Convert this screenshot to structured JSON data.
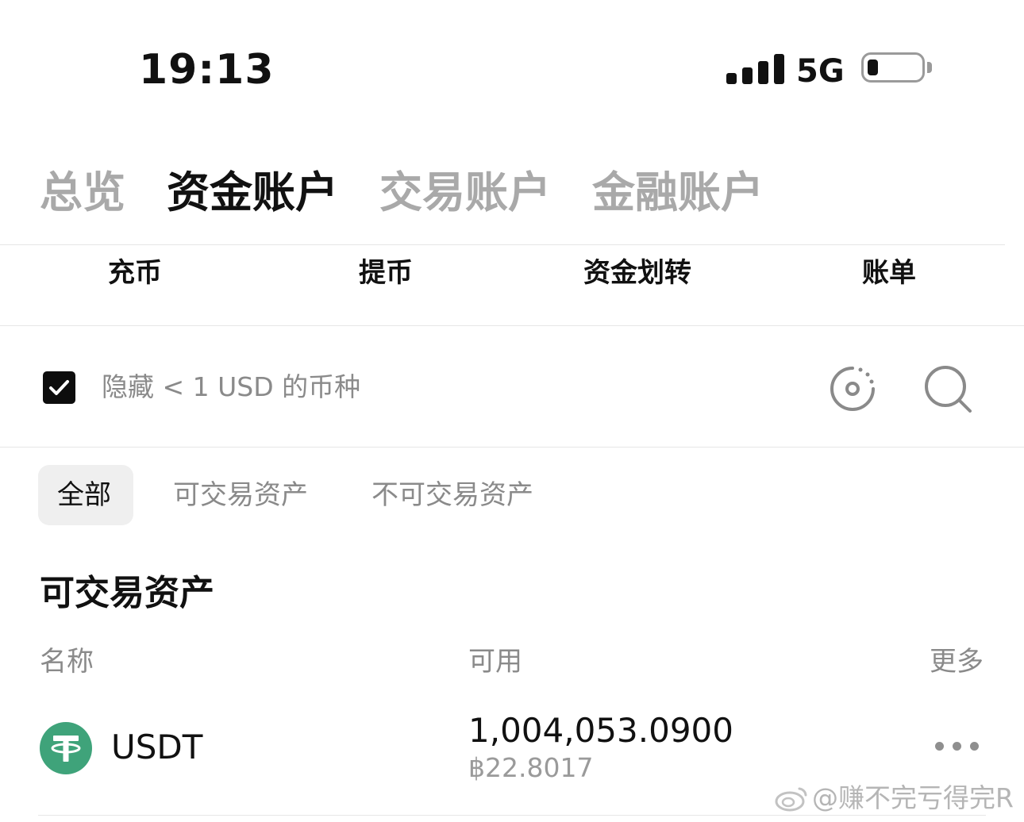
{
  "status_bar": {
    "time": "19:13",
    "network": "5G",
    "icons": [
      "signal-icon",
      "battery-icon"
    ]
  },
  "account_tabs": [
    {
      "label": "总览",
      "active": false
    },
    {
      "label": "资金账户",
      "active": true
    },
    {
      "label": "交易账户",
      "active": false
    },
    {
      "label": "金融账户",
      "active": false
    }
  ],
  "actions": [
    {
      "label": "充币"
    },
    {
      "label": "提币"
    },
    {
      "label": "资金划转"
    },
    {
      "label": "账单"
    }
  ],
  "filter": {
    "hide_small_label": "隐藏 < 1 USD 的币种",
    "hide_small_checked": true,
    "icons": [
      "target-icon",
      "search-icon"
    ]
  },
  "segments": [
    {
      "label": "全部",
      "active": true
    },
    {
      "label": "可交易资产",
      "active": false
    },
    {
      "label": "不可交易资产",
      "active": false
    }
  ],
  "section_title": "可交易资产",
  "columns": {
    "name": "名称",
    "available": "可用",
    "more": "更多"
  },
  "assets": [
    {
      "name": "USDT",
      "available": "1,004,053.0900",
      "available_fiat": "฿22.8017",
      "icon": "tether-icon",
      "icon_color": "#3fa37a"
    }
  ],
  "watermark": "@赚不完亏得完R",
  "colors": {
    "active_text": "#111111",
    "inactive_text": "#a9a9a9",
    "muted": "#8a8a8a",
    "tether": "#3fa37a"
  }
}
